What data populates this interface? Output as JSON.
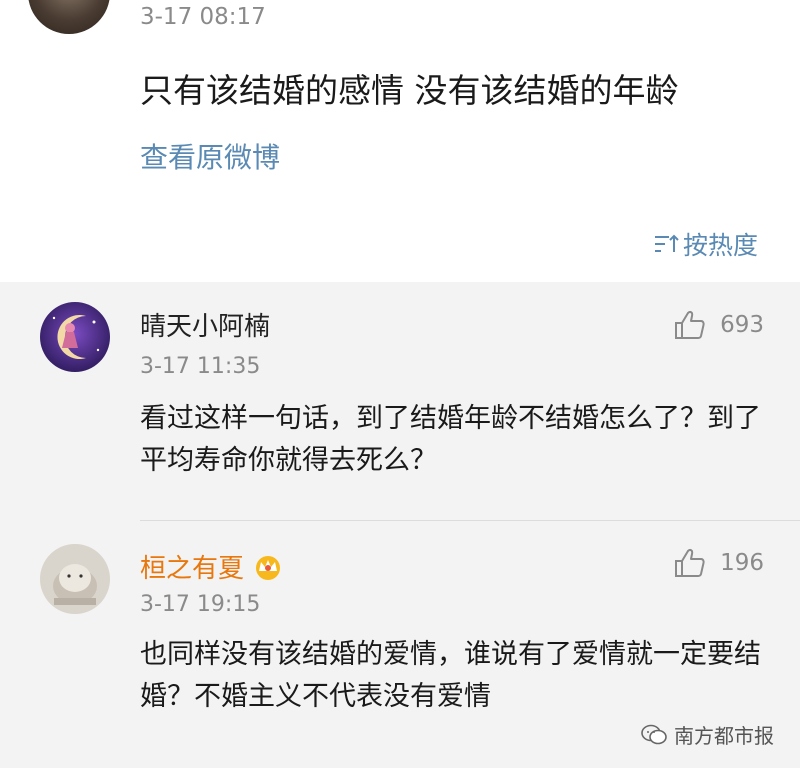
{
  "post": {
    "time": "3-17 08:17",
    "text": "只有该结婚的感情 没有该结婚的年龄",
    "view_original": "查看原微博"
  },
  "sort": {
    "label": "按热度",
    "icon": "sort-icon"
  },
  "comments": [
    {
      "name": "晴天小阿楠",
      "name_color": "#222222",
      "likes": "693",
      "time": "3-17 11:35",
      "text": "看过这样一句话，到了结婚年龄不结婚怎么了？到了平均寿命你就得去死么？"
    },
    {
      "name": "桓之有夏",
      "name_color": "#e8770e",
      "badge": "crown-badge-icon",
      "likes": "196",
      "time": "3-17 19:15",
      "text": "也同样没有该结婚的爱情，谁说有了爱情就一定要结婚？不婚主义不代表没有爱情"
    }
  ],
  "watermark": {
    "text": "南方都市报"
  }
}
